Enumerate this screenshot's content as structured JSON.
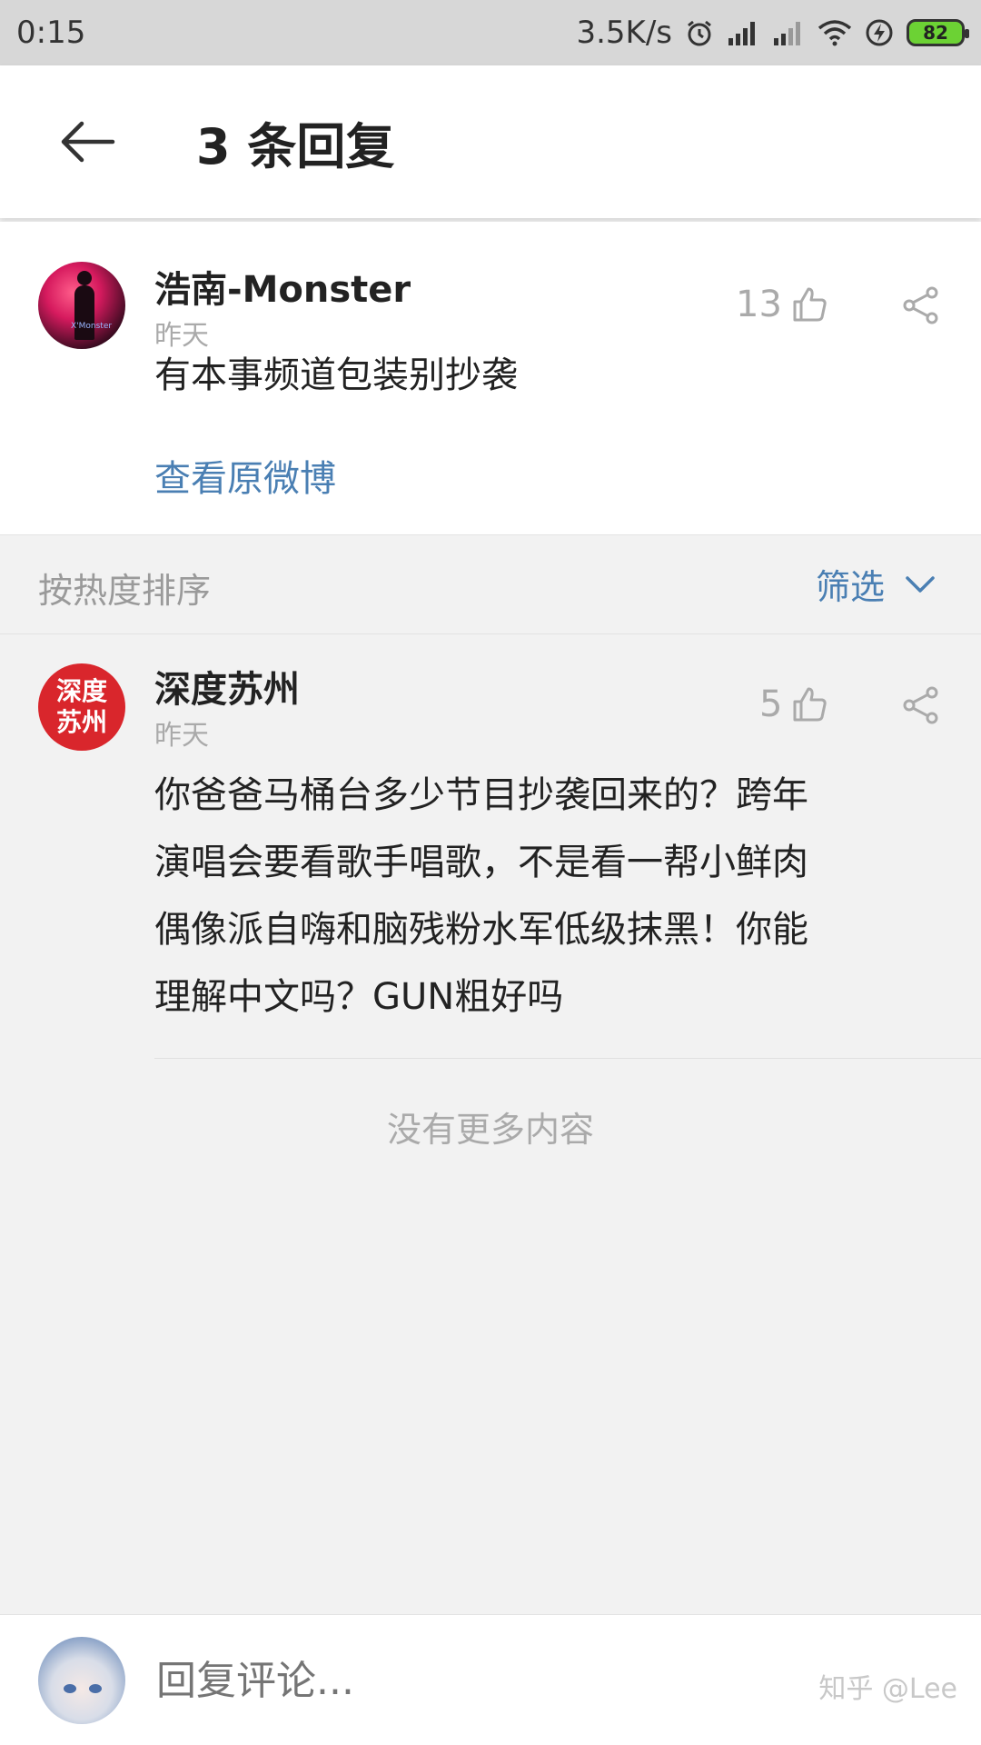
{
  "status_bar": {
    "time": "0:15",
    "net_speed": "3.5K/s",
    "battery": "82",
    "icons": [
      "alarm-icon",
      "signal-icon",
      "signal-weak-icon",
      "wifi-icon",
      "charging-icon",
      "battery-icon"
    ]
  },
  "app_bar": {
    "title": "3 条回复"
  },
  "main_comment": {
    "author": "浩南-Monster",
    "time": "昨天",
    "likes": "13",
    "text": "有本事频道包装别抄袭",
    "link": "查看原微博",
    "avatar_tag": "X'Monster"
  },
  "sort_bar": {
    "label": "按热度排序",
    "filter_label": "筛选"
  },
  "reply": {
    "author": "深度苏州",
    "avatar_text_line1": "深度",
    "avatar_text_line2": "苏州",
    "time": "昨天",
    "likes": "5",
    "text_lines": [
      "你爸爸马桶台多少节目抄袭回来的？跨年",
      "演唱会要看歌手唱歌，不是看一帮小鲜肉",
      "偶像派自嗨和脑残粉水军低级抹黑！你能",
      "理解中文吗？GUN粗好吗"
    ]
  },
  "footer_note": "没有更多内容",
  "bottom_bar": {
    "placeholder": "回复评论...",
    "watermark": "知乎 @Lee"
  },
  "colors": {
    "accent": "#4a7fb3",
    "muted": "#aaaaaa",
    "avatar_red": "#d9262c"
  }
}
